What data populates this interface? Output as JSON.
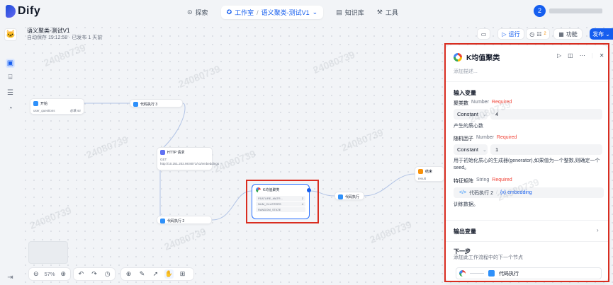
{
  "brand": {
    "name": "Dify"
  },
  "nav": {
    "explore": "探索",
    "studio": "工作室",
    "current_app": "语义聚类-测试V1",
    "knowledge": "知识库",
    "tools": "工具"
  },
  "user": {
    "avatar_letter": "2"
  },
  "app": {
    "title": "语义聚类-测试V1",
    "autosave": "自动保存 19:12:58 · 已发布 1 天前"
  },
  "toolbar": {
    "run": "运行",
    "checklist_count": "2",
    "features": "功能",
    "publish": "发布"
  },
  "nodes": {
    "start": {
      "title": "开始",
      "var": "user_questions",
      "tag": "必填 str"
    },
    "code1": {
      "title": "代码执行 3"
    },
    "http": {
      "title": "HTTP 请求",
      "method": "GET",
      "url": "http://10.251.202.98:8071/v1/embeddings"
    },
    "code2": {
      "title": "代码执行 2"
    },
    "kmeans": {
      "title": "K均值聚类",
      "rows": [
        {
          "k": "FEATURE_MATR...",
          "v": "2"
        },
        {
          "k": "NUM_CLUSTERS",
          "v": "4"
        },
        {
          "k": "RANDOM_STATE",
          "v": ""
        }
      ]
    },
    "code3": {
      "title": "代码执行"
    },
    "end": {
      "title": "结束",
      "var": "result"
    }
  },
  "zoom": "57%",
  "panel": {
    "title": "K均值聚类",
    "desc_placeholder": "添加描述...",
    "input_section": "输入变量",
    "f1_label": "聚类数",
    "f1_type": "Number",
    "required": "Required",
    "f1_mode": "Constant",
    "f1_value": "4",
    "f1_help": "产生的质心数",
    "f2_label": "随机因子",
    "f2_type": "Number",
    "f2_mode": "Constant",
    "f2_value": "1",
    "f2_help": "用于初始化质心的生成器(generator),如果值为一个整数,则确定一个seed。",
    "f3_label": "特征矩阵",
    "f3_type": "String",
    "f3_src": "代码执行 2",
    "f3_var": "{x} embedding",
    "f3_help": "训练数据。",
    "output_section": "输出变量",
    "next_section": "下一步",
    "next_help": "添加此工作流程中的下一个节点",
    "next_node": "代码执行"
  },
  "watermark": "24080739"
}
